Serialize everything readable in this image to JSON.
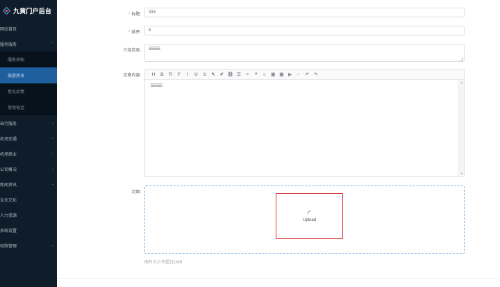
{
  "app": {
    "title": "九黄门户后台"
  },
  "sidebar": {
    "items": [
      {
        "label": "网站首页",
        "arrow": ""
      },
      {
        "label": "服务服务",
        "arrow": "⌃"
      },
      {
        "label": "出行服务",
        "arrow": "⌄"
      },
      {
        "label": "机场交通",
        "arrow": "⌄"
      },
      {
        "label": "机场商业",
        "arrow": "⌄"
      },
      {
        "label": "公司概况",
        "arrow": "⌄"
      },
      {
        "label": "新闻资讯",
        "arrow": "⌄"
      },
      {
        "label": "企业文化",
        "arrow": ""
      },
      {
        "label": "人力资源",
        "arrow": ""
      },
      {
        "label": "系统设置",
        "arrow": ""
      },
      {
        "label": "权限管理",
        "arrow": "⌄"
      }
    ],
    "subitems": [
      {
        "label": "服务须知"
      },
      {
        "label": "旅游资讯"
      },
      {
        "label": "意见反馈"
      },
      {
        "label": "常用电话"
      }
    ]
  },
  "form": {
    "title_label": "标题:",
    "title_value": "333",
    "sort_label": "排序:",
    "sort_value": "5",
    "intro_label": "介绍信息:",
    "intro_value": "55555",
    "content_label": "文章内容:",
    "content_value": "55555",
    "cover_label": "封面:",
    "upload_label": "Upload",
    "hint": "图片大小不超过1MB",
    "required_mark": "*"
  },
  "toolbar": {
    "buttons": [
      {
        "glyph": "H",
        "icon": "heading-icon"
      },
      {
        "glyph": "B",
        "icon": "bold-icon"
      },
      {
        "glyph": "TI",
        "icon": "text-size-icon"
      },
      {
        "glyph": "F",
        "icon": "font-icon"
      },
      {
        "glyph": "I",
        "icon": "italic-icon"
      },
      {
        "glyph": "U",
        "icon": "underline-icon"
      },
      {
        "glyph": "S",
        "icon": "strikethrough-icon"
      },
      {
        "glyph": "✎",
        "icon": "fore-color-icon"
      },
      {
        "glyph": "✐",
        "icon": "back-color-icon"
      },
      {
        "glyph": "⛓",
        "icon": "link-icon"
      },
      {
        "glyph": "☰",
        "icon": "list-icon"
      },
      {
        "glyph": "≡",
        "icon": "align-icon"
      },
      {
        "glyph": "❝",
        "icon": "quote-icon"
      },
      {
        "glyph": "☺",
        "icon": "emoticon-icon"
      },
      {
        "glyph": "▣",
        "icon": "image-icon"
      },
      {
        "glyph": "▦",
        "icon": "table-icon"
      },
      {
        "glyph": "▶",
        "icon": "video-icon"
      },
      {
        "glyph": "⌐",
        "icon": "code-icon"
      },
      {
        "glyph": "↶",
        "icon": "undo-icon"
      },
      {
        "glyph": "↷",
        "icon": "redo-icon"
      }
    ]
  }
}
